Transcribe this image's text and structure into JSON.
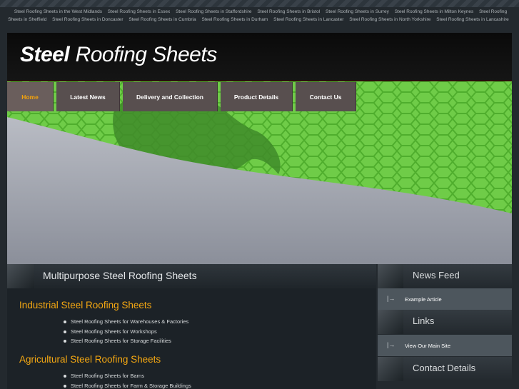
{
  "top_links": [
    "Steel Roofing Sheets in the West Midlands",
    "Steel Roofing Sheets in Essex",
    "Steel Roofing Sheets in Staffordshire",
    "Steel Roofing Sheets in Bristol",
    "Steel Roofing Sheets in Surrey",
    "Steel Roofing Sheets in Milton Keynes",
    "Steel Roofing Sheets in Sheffield",
    "Steel Roofing Sheets in Doncaster",
    "Steel Roofing Sheets in Cumbria",
    "Steel Roofing Sheets in Durham",
    "Steel Roofing Sheets in Lancaster",
    "Steel Roofing Sheets in North Yorkshire",
    "Steel Roofing Sheets in Lancashire"
  ],
  "logo": {
    "bold": "Steel",
    "thin": "Roofing Sheets"
  },
  "nav": [
    {
      "label": "Home",
      "active": true
    },
    {
      "label": "Latest News"
    },
    {
      "label": "Delivery and Collection"
    },
    {
      "label": "Product Details"
    },
    {
      "label": "Contact Us"
    }
  ],
  "main": {
    "title": "Multipurpose Steel Roofing Sheets",
    "sections": [
      {
        "heading": "Industrial Steel Roofing Sheets",
        "items": [
          "Steel Roofing Sheets for Warehouses & Factories",
          "Steel Roofing Sheets for Workshops",
          "Steel Roofing Sheets for Storage Facilities"
        ]
      },
      {
        "heading": "Agricultural Steel Roofing Sheets",
        "items": [
          "Steel Roofing Sheets for Barns",
          "Steel Roofing Sheets for Farm & Storage Buildings"
        ]
      }
    ]
  },
  "sidebar": {
    "news_title": "News Feed",
    "news_link": "Example Article",
    "links_title": "Links",
    "links_link": "View Our Main Site",
    "contact_title": "Contact Details",
    "arrow": "|→"
  },
  "colors": {
    "accent": "#f5a812",
    "banner_green": "#6fcc48",
    "nav_bg": "#584f4f"
  }
}
